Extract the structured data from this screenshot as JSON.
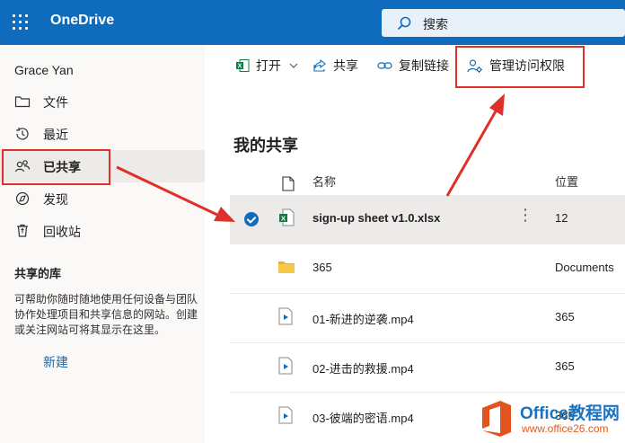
{
  "header": {
    "app_title": "OneDrive",
    "search_placeholder": "搜索"
  },
  "sidebar": {
    "user_name": "Grace Yan",
    "items": [
      {
        "label": "文件",
        "icon": "folder-icon"
      },
      {
        "label": "最近",
        "icon": "clock-icon"
      },
      {
        "label": "已共享",
        "icon": "people-icon",
        "active": true
      },
      {
        "label": "发现",
        "icon": "compass-icon"
      },
      {
        "label": "回收站",
        "icon": "recycle-bin-icon"
      }
    ],
    "libraries_title": "共享的库",
    "libraries_desc": "可帮助你随时随地使用任何设备与团队协作处理项目和共享信息的网站。创建或关注网站可将其显示在这里。",
    "new_label": "新建"
  },
  "toolbar": {
    "open_label": "打开",
    "share_label": "共享",
    "copy_link_label": "复制链接",
    "manage_access_label": "管理访问权限"
  },
  "main": {
    "title": "我的共享",
    "columns": {
      "name": "名称",
      "location": "位置"
    },
    "files": [
      {
        "name": "sign-up sheet v1.0.xlsx",
        "location": "12",
        "type": "excel",
        "selected": true
      },
      {
        "name": "365",
        "location": "Documents",
        "type": "folder"
      },
      {
        "name": "01-新进的逆袭.mp4",
        "location": "365",
        "type": "video"
      },
      {
        "name": "02-进击的救援.mp4",
        "location": "365",
        "type": "video"
      },
      {
        "name": "03-彼端的密语.mp4",
        "location": "365",
        "type": "video"
      }
    ]
  },
  "watermark": {
    "name": "Office教程网",
    "url": "www.office26.com"
  },
  "colors": {
    "brand": "#0f6cbd",
    "highlight": "#e0302a",
    "selected_row": "#edebe9"
  }
}
